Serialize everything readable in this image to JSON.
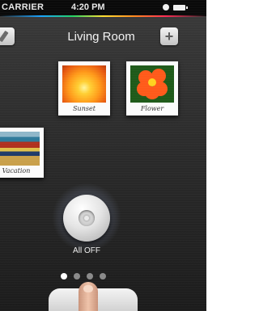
{
  "status_bar": {
    "carrier": "CARRIER",
    "time": "4:20 PM"
  },
  "header": {
    "title": "Living Room"
  },
  "scenes": [
    {
      "caption": "Sunset"
    },
    {
      "caption": "Flower"
    },
    {
      "caption": "Vacation"
    }
  ],
  "control": {
    "label": "All OFF"
  },
  "pagination": {
    "current": 1,
    "total": 4
  },
  "colors": {
    "background": "#2c2c2c",
    "text": "#f2f2f2"
  }
}
